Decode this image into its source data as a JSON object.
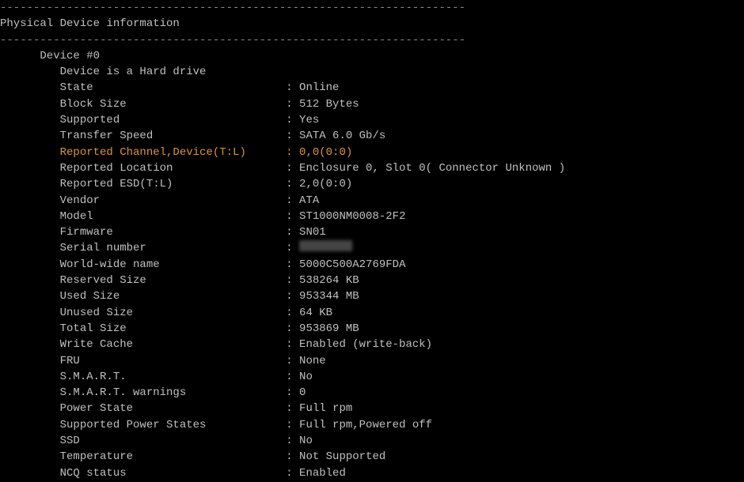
{
  "dash_line": "----------------------------------------------------------------------",
  "section_title": "Physical Device information",
  "device_header": "Device #0",
  "device_type_line": "Device is a Hard drive",
  "rows": [
    {
      "label": "State",
      "value": "Online",
      "highlight": false
    },
    {
      "label": "Block Size",
      "value": "512 Bytes",
      "highlight": false
    },
    {
      "label": "Supported",
      "value": "Yes",
      "highlight": false
    },
    {
      "label": "Transfer Speed",
      "value": "SATA 6.0 Gb/s",
      "highlight": false
    },
    {
      "label": "Reported Channel,Device(T:L)",
      "value": "0,0(0:0)",
      "highlight": true
    },
    {
      "label": "Reported Location",
      "value": "Enclosure 0, Slot 0( Connector Unknown )",
      "highlight": false
    },
    {
      "label": "Reported ESD(T:L)",
      "value": "2,0(0:0)",
      "highlight": false
    },
    {
      "label": "Vendor",
      "value": "ATA",
      "highlight": false
    },
    {
      "label": "Model",
      "value": "ST1000NM0008-2F2",
      "highlight": false
    },
    {
      "label": "Firmware",
      "value": "SN01",
      "highlight": false
    },
    {
      "label": "Serial number",
      "value": "",
      "highlight": false,
      "redacted": true
    },
    {
      "label": "World-wide name",
      "value": "5000C500A2769FDA",
      "highlight": false
    },
    {
      "label": "Reserved Size",
      "value": "538264 KB",
      "highlight": false
    },
    {
      "label": "Used Size",
      "value": "953344 MB",
      "highlight": false
    },
    {
      "label": "Unused Size",
      "value": "64 KB",
      "highlight": false
    },
    {
      "label": "Total Size",
      "value": "953869 MB",
      "highlight": false
    },
    {
      "label": "Write Cache",
      "value": "Enabled (write-back)",
      "highlight": false
    },
    {
      "label": "FRU",
      "value": "None",
      "highlight": false
    },
    {
      "label": "S.M.A.R.T.",
      "value": "No",
      "highlight": false
    },
    {
      "label": "S.M.A.R.T. warnings",
      "value": "0",
      "highlight": false
    },
    {
      "label": "Power State",
      "value": "Full rpm",
      "highlight": false
    },
    {
      "label": "Supported Power States",
      "value": "Full rpm,Powered off",
      "highlight": false
    },
    {
      "label": "SSD",
      "value": "No",
      "highlight": false
    },
    {
      "label": "Temperature",
      "value": "Not Supported",
      "highlight": false
    },
    {
      "label": "NCQ status",
      "value": "Enabled",
      "highlight": false
    }
  ]
}
